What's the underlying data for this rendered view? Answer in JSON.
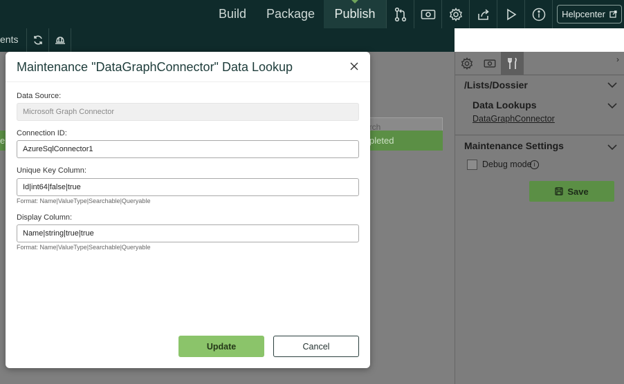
{
  "topbar": {
    "nav": [
      "Build",
      "Package",
      "Publish"
    ],
    "active": "Publish",
    "icons": [
      "branch-icon",
      "money-icon",
      "gear-icon",
      "share-icon",
      "play-icon",
      "info-icon"
    ],
    "helpcenter_label": "Helpcenter"
  },
  "subbar": {
    "partial_text": "ents",
    "icons": [
      "refresh-icon",
      "crab-icon"
    ]
  },
  "background": {
    "search_placeholder": "arch",
    "status_text": "pleted",
    "status_partial_left": "e"
  },
  "right_panel": {
    "tabs": [
      "gear-icon",
      "money-icon",
      "tools-icon"
    ],
    "path_title": "/Lists/Dossier",
    "data_lookups_title": "Data Lookups",
    "lookup_link": "DataGraphConnector",
    "maintenance_title": "Maintenance Settings",
    "debug_label": "Debug mode",
    "save_label": "Save"
  },
  "dialog": {
    "title": "Maintenance \"DataGraphConnector\" Data Lookup",
    "fields": {
      "data_source": {
        "label": "Data Source:",
        "value": "Microsoft Graph Connector"
      },
      "connection_id": {
        "label": "Connection ID:",
        "value": "AzureSqlConnector1"
      },
      "unique_key": {
        "label": "Unique Key Column:",
        "value": "Id|int64|false|true",
        "hint": "Format: Name|ValueType|Searchable|Queryable"
      },
      "display_column": {
        "label": "Display Column:",
        "value": "Name|string|true|true",
        "hint": "Format: Name|ValueType|Searchable|Queryable"
      }
    },
    "update_label": "Update",
    "cancel_label": "Cancel"
  },
  "colors": {
    "topbar": "#0f2b2b",
    "accent_green": "#8bc46a",
    "title_teal": "#1d3c3a"
  }
}
